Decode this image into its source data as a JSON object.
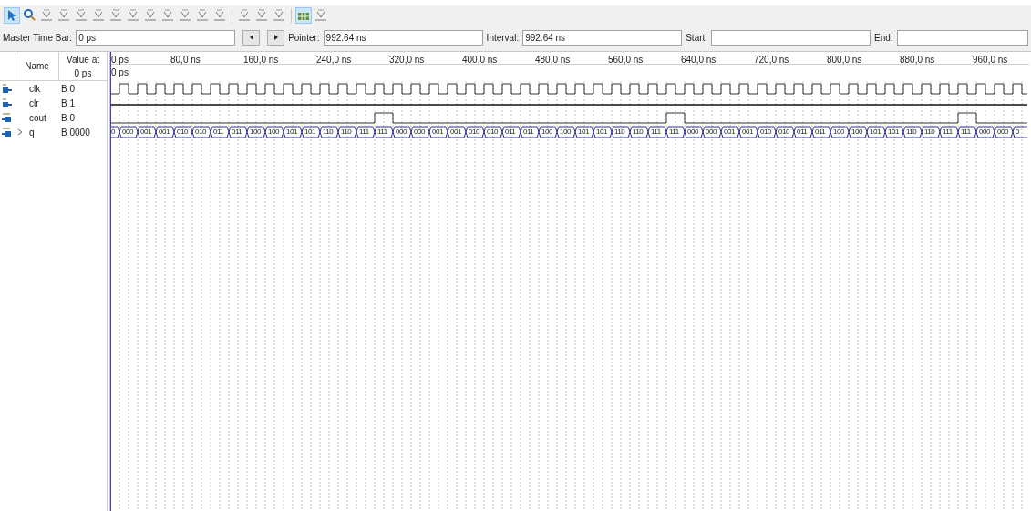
{
  "toolbar": [
    {
      "kind": "pointer",
      "selected": true
    },
    {
      "kind": "zoom",
      "selected": false
    },
    {
      "kind": "tool",
      "selected": false
    },
    {
      "kind": "tool",
      "selected": false
    },
    {
      "kind": "tool",
      "selected": false
    },
    {
      "kind": "tool",
      "selected": false
    },
    {
      "kind": "tool",
      "selected": false
    },
    {
      "kind": "tool",
      "selected": false
    },
    {
      "kind": "tool",
      "selected": false
    },
    {
      "kind": "tool",
      "selected": false
    },
    {
      "kind": "tool",
      "selected": false
    },
    {
      "kind": "tool",
      "selected": false
    },
    {
      "kind": "tool",
      "selected": false
    },
    {
      "kind": "separator"
    },
    {
      "kind": "tool",
      "selected": false
    },
    {
      "kind": "tool",
      "selected": false
    },
    {
      "kind": "tool",
      "selected": false
    },
    {
      "kind": "separator"
    },
    {
      "kind": "grid",
      "selected": true
    },
    {
      "kind": "tool",
      "selected": false
    }
  ],
  "time_bar": {
    "master_label": "Master Time Bar:",
    "master_value": "0 ps",
    "pointer_label": "Pointer:",
    "pointer_value": "992.64 ns",
    "interval_label": "Interval:",
    "interval_value": "992.64 ns",
    "start_label": "Start:",
    "end_label": "End:"
  },
  "signal_table": {
    "columns": [
      "Name",
      "Value at\n0 ps"
    ],
    "rows": [
      {
        "name": "clk",
        "kind": "input",
        "value": "B 0",
        "expandable": false
      },
      {
        "name": "clr",
        "kind": "input",
        "value": "B 1",
        "expandable": false
      },
      {
        "name": "cout",
        "kind": "output",
        "value": "B 0",
        "expandable": false
      },
      {
        "name": "q",
        "kind": "output",
        "value": "B 0000",
        "expandable": true
      }
    ]
  },
  "timeline": {
    "ticks": [
      "0 ps",
      "80,0 ns",
      "160,0 ns",
      "240,0 ns",
      "320,0 ns",
      "400,0 ns",
      "480,0 ns",
      "560,0 ns",
      "640,0 ns",
      "720,0 ns",
      "800,0 ns",
      "880,0 ns",
      "960,0 ns"
    ],
    "cursor_label": "0 ps"
  },
  "q_segments": [
    "0",
    "000",
    "001",
    "001",
    "010",
    "010",
    "011",
    "011",
    "100",
    "100",
    "101",
    "101",
    "110",
    "110",
    "111",
    "111",
    "000",
    "000",
    "001",
    "001",
    "010",
    "010",
    "011",
    "011",
    "100",
    "100",
    "101",
    "101",
    "110",
    "110",
    "111",
    "111",
    "000",
    "000",
    "001",
    "001",
    "010",
    "010",
    "011",
    "011",
    "100",
    "100",
    "101",
    "101",
    "110",
    "110",
    "111",
    "111",
    "000",
    "000",
    "0"
  ]
}
